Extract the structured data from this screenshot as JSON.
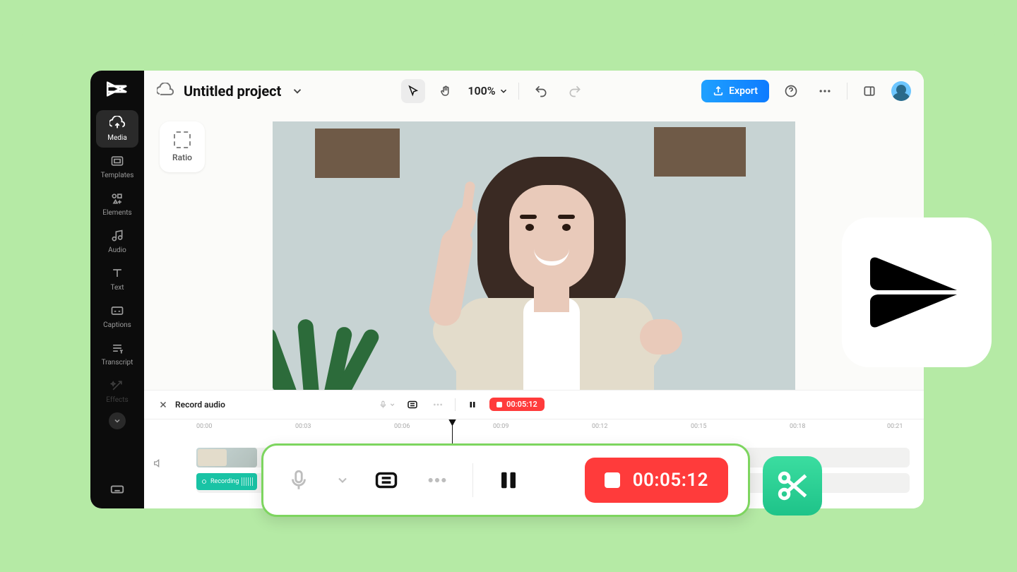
{
  "project": {
    "title": "Untitled project"
  },
  "topbar": {
    "zoom": "100%",
    "export_label": "Export"
  },
  "sidebar": {
    "items": [
      {
        "label": "Media"
      },
      {
        "label": "Templates"
      },
      {
        "label": "Elements"
      },
      {
        "label": "Audio"
      },
      {
        "label": "Text"
      },
      {
        "label": "Captions"
      },
      {
        "label": "Transcript"
      },
      {
        "label": "Effects"
      }
    ]
  },
  "ratio_label": "Ratio",
  "record_bar": {
    "title": "Record audio",
    "badge_time": "00:05:12"
  },
  "timeline": {
    "marks": [
      "00:00",
      "00:03",
      "00:06",
      "00:09",
      "00:12",
      "00:15",
      "00:18",
      "00:21"
    ],
    "clip_label": "Recording"
  },
  "float": {
    "time": "00:05:12"
  }
}
